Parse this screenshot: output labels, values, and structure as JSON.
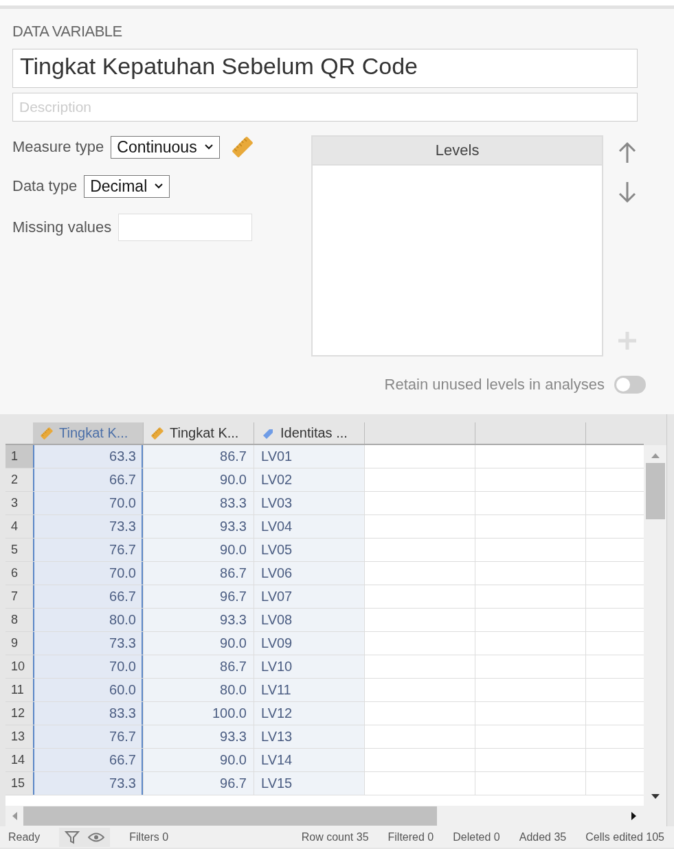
{
  "panel": {
    "title": "DATA VARIABLE",
    "name": "Tingkat Kepatuhan Sebelum QR Code",
    "description": {
      "placeholder": "Description"
    },
    "measure_type": {
      "label": "Measure type",
      "value": "Continuous",
      "kind": "continuous"
    },
    "data_type": {
      "label": "Data type",
      "value": "Decimal"
    },
    "missing_values": {
      "label": "Missing values"
    },
    "levels": {
      "header": "Levels"
    },
    "retain": {
      "label": "Retain unused levels in analyses",
      "on": false
    }
  },
  "sheet": {
    "columns": [
      {
        "label": "Tingkat K...",
        "kind": "continuous",
        "selected": true
      },
      {
        "label": "Tingkat K...",
        "kind": "continuous",
        "selected": false
      },
      {
        "label": "Identitas ...",
        "kind": "text",
        "selected": false
      }
    ],
    "rows": [
      {
        "number": "1",
        "selected": true,
        "cells": [
          "63.3",
          "86.7",
          "LV01"
        ]
      },
      {
        "number": "2",
        "selected": false,
        "cells": [
          "66.7",
          "90.0",
          "LV02"
        ]
      },
      {
        "number": "3",
        "selected": false,
        "cells": [
          "70.0",
          "83.3",
          "LV03"
        ]
      },
      {
        "number": "4",
        "selected": false,
        "cells": [
          "73.3",
          "93.3",
          "LV04"
        ]
      },
      {
        "number": "5",
        "selected": false,
        "cells": [
          "76.7",
          "90.0",
          "LV05"
        ]
      },
      {
        "number": "6",
        "selected": false,
        "cells": [
          "70.0",
          "86.7",
          "LV06"
        ]
      },
      {
        "number": "7",
        "selected": false,
        "cells": [
          "66.7",
          "96.7",
          "LV07"
        ]
      },
      {
        "number": "8",
        "selected": false,
        "cells": [
          "80.0",
          "93.3",
          "LV08"
        ]
      },
      {
        "number": "9",
        "selected": false,
        "cells": [
          "73.3",
          "90.0",
          "LV09"
        ]
      },
      {
        "number": "10",
        "selected": false,
        "cells": [
          "70.0",
          "86.7",
          "LV10"
        ]
      },
      {
        "number": "11",
        "selected": false,
        "cells": [
          "60.0",
          "80.0",
          "LV11"
        ]
      },
      {
        "number": "12",
        "selected": false,
        "cells": [
          "83.3",
          "100.0",
          "LV12"
        ]
      },
      {
        "number": "13",
        "selected": false,
        "cells": [
          "76.7",
          "93.3",
          "LV13"
        ]
      },
      {
        "number": "14",
        "selected": false,
        "cells": [
          "66.7",
          "90.0",
          "LV14"
        ]
      },
      {
        "number": "15",
        "selected": false,
        "cells": [
          "73.3",
          "96.7",
          "LV15"
        ]
      }
    ]
  },
  "status_bar": {
    "state": "Ready",
    "filters": "Filters 0",
    "row_count": "Row count 35",
    "filtered": "Filtered 0",
    "deleted": "Deleted 0",
    "added": "Added 35",
    "cells_edited": "Cells edited 105"
  }
}
